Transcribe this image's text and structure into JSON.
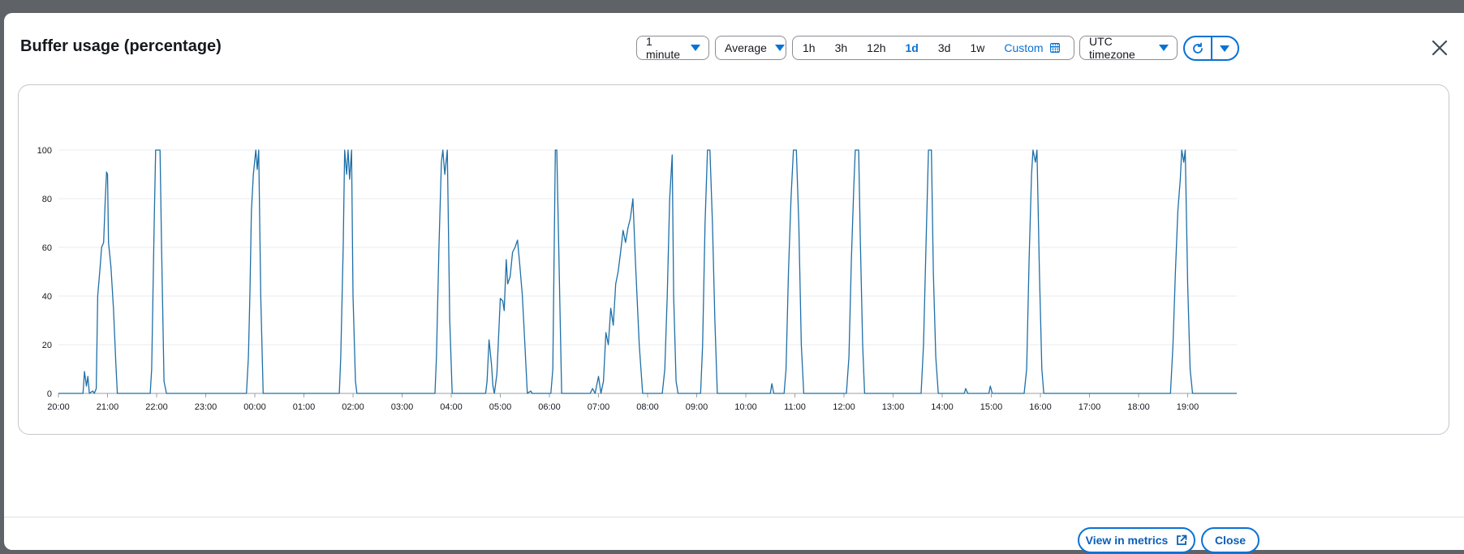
{
  "modal": {
    "title": "Buffer usage (percentage)",
    "period_select": "1 minute",
    "stat_select": "Average",
    "ranges": [
      {
        "label": "1h",
        "selected": false
      },
      {
        "label": "3h",
        "selected": false
      },
      {
        "label": "12h",
        "selected": false
      },
      {
        "label": "1d",
        "selected": true
      },
      {
        "label": "3d",
        "selected": false
      },
      {
        "label": "1w",
        "selected": false
      }
    ],
    "custom_label": "Custom",
    "timezone_select": "UTC timezone",
    "view_in_metrics_label": "View in metrics",
    "close_label": "Close"
  },
  "colors": {
    "accent": "#0972d3",
    "line": "#1e6fa8",
    "grid": "#e9ebed"
  },
  "icons": {
    "calendar": "calendar-icon",
    "refresh": "refresh-icon",
    "dropdown": "caret-down-icon",
    "close": "close-icon",
    "external": "external-link-icon"
  },
  "chart_data": {
    "type": "line",
    "title": "",
    "xlabel": "",
    "ylabel": "",
    "ylim": [
      0,
      100
    ],
    "yticks": [
      0,
      20,
      40,
      60,
      80,
      100
    ],
    "xlim": [
      20.0,
      44.0
    ],
    "xticks": [
      "20:00",
      "21:00",
      "22:00",
      "23:00",
      "00:00",
      "01:00",
      "02:00",
      "03:00",
      "04:00",
      "05:00",
      "06:00",
      "07:00",
      "08:00",
      "09:00",
      "10:00",
      "11:00",
      "12:00",
      "13:00",
      "14:00",
      "15:00",
      "16:00",
      "17:00",
      "18:00",
      "19:00"
    ],
    "grid": true,
    "legend": "none",
    "series": [
      {
        "name": "",
        "points": [
          [
            20.0,
            0
          ],
          [
            20.33,
            0
          ],
          [
            20.5,
            0
          ],
          [
            20.53,
            9
          ],
          [
            20.57,
            3
          ],
          [
            20.6,
            7
          ],
          [
            20.63,
            0
          ],
          [
            20.7,
            1
          ],
          [
            20.73,
            0
          ],
          [
            20.77,
            2
          ],
          [
            20.8,
            40
          ],
          [
            20.85,
            52
          ],
          [
            20.88,
            60
          ],
          [
            20.92,
            62
          ],
          [
            20.95,
            78
          ],
          [
            20.98,
            91
          ],
          [
            21.0,
            90
          ],
          [
            21.02,
            62
          ],
          [
            21.07,
            52
          ],
          [
            21.12,
            35
          ],
          [
            21.17,
            12
          ],
          [
            21.2,
            0
          ],
          [
            21.25,
            0
          ],
          [
            21.87,
            0
          ],
          [
            21.9,
            10
          ],
          [
            21.95,
            70
          ],
          [
            21.98,
            100
          ],
          [
            22.07,
            100
          ],
          [
            22.1,
            60
          ],
          [
            22.15,
            5
          ],
          [
            22.2,
            0
          ],
          [
            23.83,
            0
          ],
          [
            23.87,
            15
          ],
          [
            23.9,
            40
          ],
          [
            23.93,
            75
          ],
          [
            23.97,
            90
          ],
          [
            24.02,
            100
          ],
          [
            24.05,
            92
          ],
          [
            24.08,
            100
          ],
          [
            24.12,
            40
          ],
          [
            24.17,
            0
          ],
          [
            25.72,
            0
          ],
          [
            25.75,
            15
          ],
          [
            25.8,
            60
          ],
          [
            25.83,
            100
          ],
          [
            25.87,
            90
          ],
          [
            25.9,
            100
          ],
          [
            25.93,
            88
          ],
          [
            25.97,
            100
          ],
          [
            26.0,
            40
          ],
          [
            26.05,
            5
          ],
          [
            26.08,
            0
          ],
          [
            27.67,
            0
          ],
          [
            27.7,
            15
          ],
          [
            27.75,
            60
          ],
          [
            27.8,
            95
          ],
          [
            27.83,
            100
          ],
          [
            27.87,
            90
          ],
          [
            27.92,
            100
          ],
          [
            27.97,
            30
          ],
          [
            28.02,
            0
          ],
          [
            28.7,
            0
          ],
          [
            28.73,
            5
          ],
          [
            28.77,
            22
          ],
          [
            28.82,
            12
          ],
          [
            28.85,
            3
          ],
          [
            28.88,
            0
          ],
          [
            28.93,
            8
          ],
          [
            29.0,
            39
          ],
          [
            29.05,
            38
          ],
          [
            29.08,
            34
          ],
          [
            29.12,
            55
          ],
          [
            29.15,
            45
          ],
          [
            29.2,
            48
          ],
          [
            29.25,
            58
          ],
          [
            29.3,
            60
          ],
          [
            29.35,
            63
          ],
          [
            29.4,
            52
          ],
          [
            29.45,
            40
          ],
          [
            29.5,
            20
          ],
          [
            29.55,
            0
          ],
          [
            29.62,
            1
          ],
          [
            29.65,
            0
          ],
          [
            30.03,
            0
          ],
          [
            30.07,
            10
          ],
          [
            30.12,
            100
          ],
          [
            30.15,
            100
          ],
          [
            30.2,
            50
          ],
          [
            30.25,
            0
          ],
          [
            30.83,
            0
          ],
          [
            30.88,
            2
          ],
          [
            30.93,
            0
          ],
          [
            31.0,
            7
          ],
          [
            31.05,
            0
          ],
          [
            31.1,
            5
          ],
          [
            31.15,
            25
          ],
          [
            31.2,
            20
          ],
          [
            31.25,
            35
          ],
          [
            31.3,
            28
          ],
          [
            31.35,
            45
          ],
          [
            31.4,
            50
          ],
          [
            31.45,
            58
          ],
          [
            31.5,
            67
          ],
          [
            31.55,
            62
          ],
          [
            31.6,
            68
          ],
          [
            31.65,
            72
          ],
          [
            31.7,
            80
          ],
          [
            31.75,
            55
          ],
          [
            31.83,
            20
          ],
          [
            31.9,
            0
          ],
          [
            32.0,
            0
          ],
          [
            32.3,
            0
          ],
          [
            32.35,
            10
          ],
          [
            32.4,
            40
          ],
          [
            32.45,
            80
          ],
          [
            32.5,
            98
          ],
          [
            32.53,
            40
          ],
          [
            32.58,
            5
          ],
          [
            32.62,
            0
          ],
          [
            33.08,
            0
          ],
          [
            33.12,
            20
          ],
          [
            33.17,
            70
          ],
          [
            33.22,
            100
          ],
          [
            33.27,
            100
          ],
          [
            33.32,
            70
          ],
          [
            33.37,
            30
          ],
          [
            33.42,
            0
          ],
          [
            34.5,
            0
          ],
          [
            34.53,
            4
          ],
          [
            34.57,
            0
          ],
          [
            34.78,
            0
          ],
          [
            34.82,
            10
          ],
          [
            34.87,
            50
          ],
          [
            34.92,
            80
          ],
          [
            34.97,
            100
          ],
          [
            35.03,
            100
          ],
          [
            35.08,
            70
          ],
          [
            35.13,
            20
          ],
          [
            35.18,
            0
          ],
          [
            36.05,
            0
          ],
          [
            36.1,
            15
          ],
          [
            36.15,
            55
          ],
          [
            36.2,
            85
          ],
          [
            36.23,
            100
          ],
          [
            36.3,
            100
          ],
          [
            36.33,
            65
          ],
          [
            36.38,
            20
          ],
          [
            36.42,
            0
          ],
          [
            37.57,
            0
          ],
          [
            37.62,
            20
          ],
          [
            37.67,
            60
          ],
          [
            37.72,
            100
          ],
          [
            37.78,
            100
          ],
          [
            37.82,
            50
          ],
          [
            37.87,
            15
          ],
          [
            37.92,
            0
          ],
          [
            38.45,
            0
          ],
          [
            38.48,
            2
          ],
          [
            38.52,
            0
          ],
          [
            38.95,
            0
          ],
          [
            38.98,
            3
          ],
          [
            39.02,
            0
          ],
          [
            39.67,
            0
          ],
          [
            39.72,
            10
          ],
          [
            39.77,
            55
          ],
          [
            39.82,
            90
          ],
          [
            39.85,
            100
          ],
          [
            39.9,
            95
          ],
          [
            39.93,
            100
          ],
          [
            39.98,
            50
          ],
          [
            40.03,
            10
          ],
          [
            40.07,
            0
          ],
          [
            42.65,
            0
          ],
          [
            42.7,
            20
          ],
          [
            42.75,
            50
          ],
          [
            42.8,
            75
          ],
          [
            42.85,
            88
          ],
          [
            42.88,
            100
          ],
          [
            42.92,
            95
          ],
          [
            42.95,
            100
          ],
          [
            43.0,
            45
          ],
          [
            43.05,
            10
          ],
          [
            43.1,
            0
          ],
          [
            44.0,
            0
          ]
        ]
      }
    ]
  }
}
